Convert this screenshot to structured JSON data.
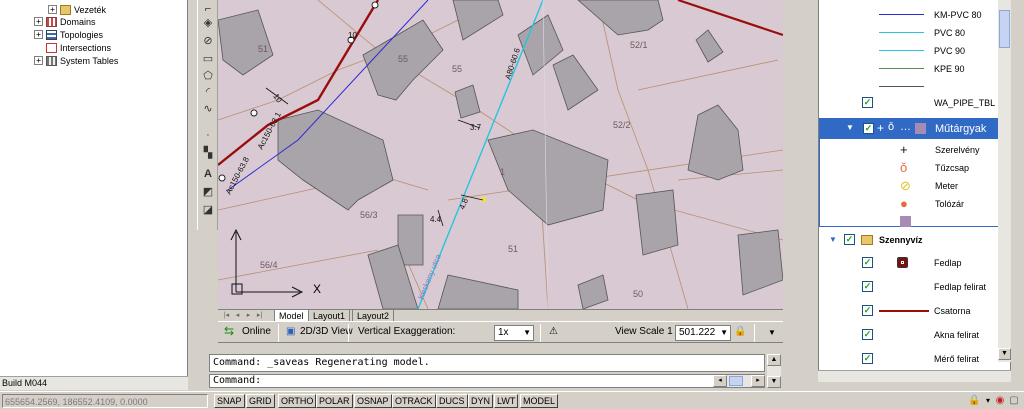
{
  "tree": {
    "items": [
      {
        "label": "Vezeték",
        "expander": "+"
      },
      {
        "label": "Domains",
        "expander": "+"
      },
      {
        "label": "Topologies",
        "expander": "+"
      },
      {
        "label": "Intersections",
        "expander": ""
      },
      {
        "label": "System Tables",
        "expander": "+"
      }
    ],
    "build": "Build M044"
  },
  "map": {
    "parcel_labels": [
      "51",
      "55",
      "55",
      "52/1",
      "52/2",
      "51",
      "56/3",
      "56/4",
      "50",
      "1"
    ],
    "line_labels": {
      "pipe_a": "A80-60.6",
      "pipe_b": "Ac150-63.1",
      "pipe_c": "Ac150-63.8",
      "dim_1": "10",
      "dim_2": "10",
      "dim_3": "3.7",
      "dim_4": "4.4",
      "dim_5": "4.8",
      "street": "Keskeny utca"
    },
    "ucs_x": "X"
  },
  "layout_tabs": [
    "Model",
    "Layout1",
    "Layout2"
  ],
  "map_status": {
    "online": "Online",
    "view_2d3d": "2D/3D View",
    "vertical_exaggeration_label": "Vertical Exaggeration:",
    "vertical_exaggeration_value": "1x",
    "view_scale_label": "View Scale  1 :",
    "view_scale_value": "501.222"
  },
  "command": {
    "history": "Command: _saveas Regenerating model.",
    "prompt": "Command:"
  },
  "layers": {
    "legend_items": [
      {
        "label": "KM-PVC 80",
        "color": "#2b2bd6"
      },
      {
        "label": "PVC 80",
        "color": "#26c4e0"
      },
      {
        "label": "PVC 90",
        "color": "#26c4e0"
      },
      {
        "label": "KPE 90",
        "color": "#5a8a5a"
      },
      {
        "label": "",
        "color": "#555555"
      }
    ],
    "wa_pipe_tbl": "WA_PIPE_TBL",
    "mutargyak": "Műtárgyak",
    "mutargyak_items": [
      {
        "label": "Szerelvény",
        "icon": "cross-icon"
      },
      {
        "label": "Tűzcsap",
        "icon": "hydrant-icon"
      },
      {
        "label": "Meter",
        "icon": "meter-icon"
      },
      {
        "label": "Tolózár",
        "icon": "valve-icon"
      },
      {
        "label": "",
        "icon": "square-icon"
      }
    ],
    "szennyviz": "Szennyvíz",
    "szennyviz_items": [
      {
        "label": "Fedlap",
        "icon": "manhole-icon"
      },
      {
        "label": "Fedlap felirat",
        "icon": ""
      },
      {
        "label": "Csatorna",
        "icon": "sewer-line-icon"
      },
      {
        "label": "Akna felirat",
        "icon": ""
      },
      {
        "label": "Mérő felirat",
        "icon": ""
      }
    ]
  },
  "statusbar": {
    "coords": "655654.2569, 186552.4109, 0.0000",
    "buttons": [
      "SNAP",
      "GRID",
      "ORTHO",
      "POLAR",
      "OSNAP",
      "OTRACK",
      "DUCS",
      "DYN",
      "LWT",
      "MODEL"
    ]
  },
  "colors": {
    "map_bg": "#d9c9d2",
    "building": "#a9a3aa",
    "selection": "#316ac5",
    "pipe_red": "#9a0d0d",
    "pipe_blue": "#2b2bd6",
    "pipe_cyan": "#26c4e0"
  }
}
